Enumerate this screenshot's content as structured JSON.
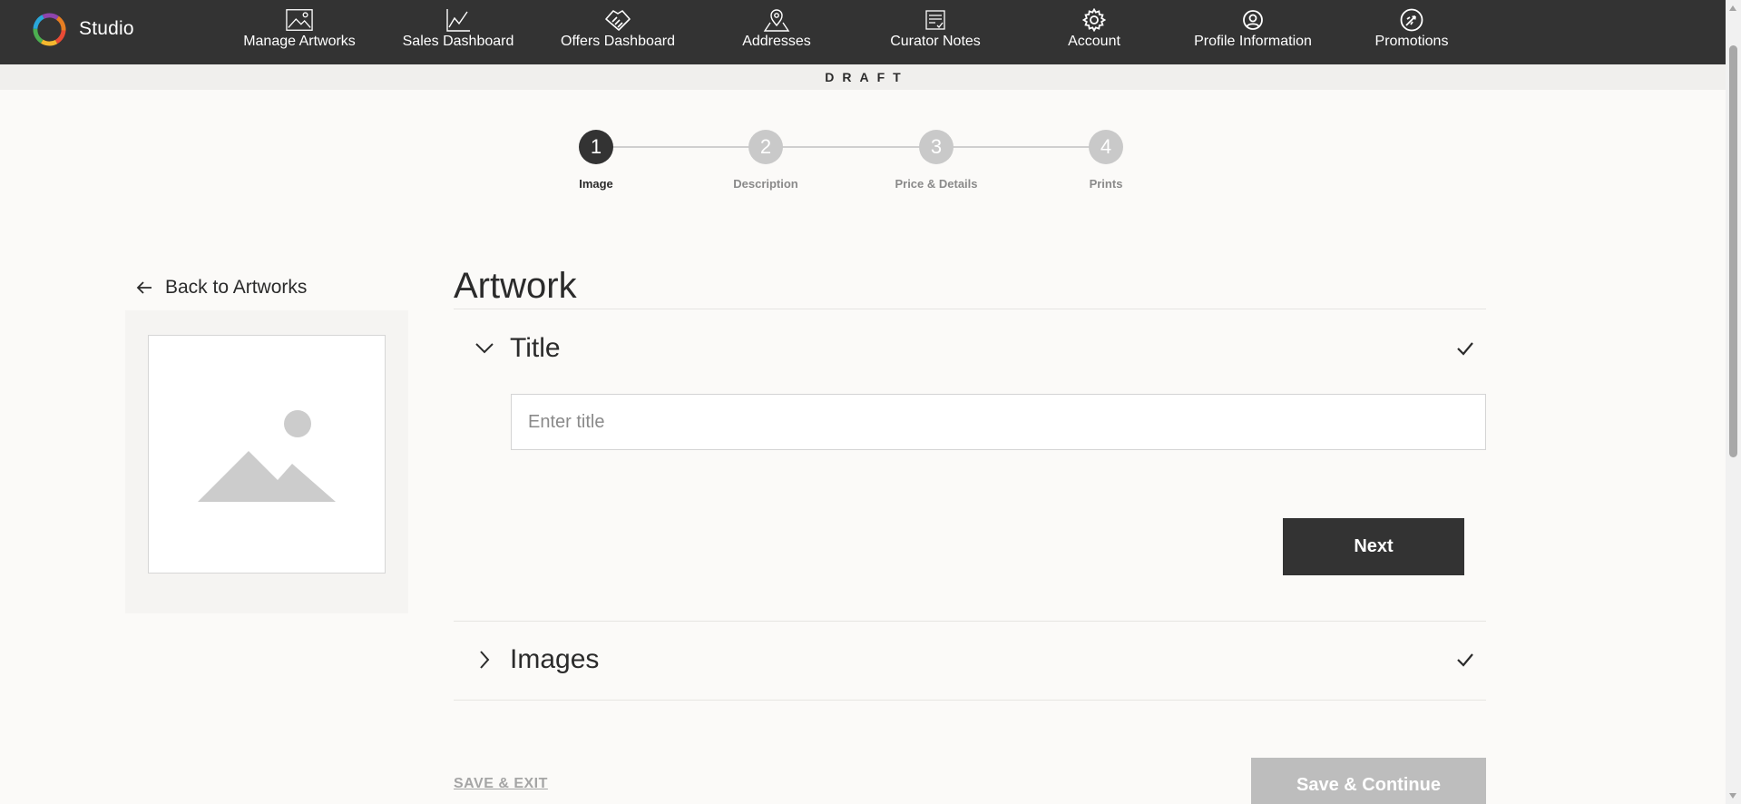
{
  "app": {
    "brand_label": "Studio",
    "brand_icon": "multicolor-ring-logo"
  },
  "nav": {
    "items": [
      {
        "label": "Manage Artworks",
        "icon": "image-icon"
      },
      {
        "label": "Sales Dashboard",
        "icon": "line-chart-icon"
      },
      {
        "label": "Offers Dashboard",
        "icon": "handshake-icon"
      },
      {
        "label": "Addresses",
        "icon": "map-pin-icon"
      },
      {
        "label": "Curator Notes",
        "icon": "notes-icon"
      },
      {
        "label": "Account",
        "icon": "gear-icon"
      },
      {
        "label": "Profile Information",
        "icon": "user-circle-icon"
      },
      {
        "label": "Promotions",
        "icon": "rocket-icon"
      }
    ]
  },
  "status": {
    "draft_label": "DRAFT"
  },
  "stepper": {
    "current": 1,
    "steps": [
      {
        "number": "1",
        "label": "Image"
      },
      {
        "number": "2",
        "label": "Description"
      },
      {
        "number": "3",
        "label": "Price & Details"
      },
      {
        "number": "4",
        "label": "Prints"
      }
    ]
  },
  "sidebar": {
    "back_label": "Back to Artworks",
    "preview_icon": "image-placeholder-icon"
  },
  "main": {
    "heading": "Artwork",
    "title_section": {
      "label": "Title",
      "expanded": true,
      "complete": true,
      "input_value": "",
      "input_placeholder": "Enter title",
      "next_label": "Next"
    },
    "images_section": {
      "label": "Images",
      "expanded": false,
      "complete": true
    }
  },
  "footer": {
    "save_exit_label": "SAVE & EXIT",
    "save_continue_label": "Save & Continue"
  },
  "colors": {
    "nav_bg": "#333333",
    "page_bg": "#fbfaf8",
    "active_step": "#333333",
    "inactive_step": "#c9c9c9",
    "disabled_button": "#bdbdbd"
  }
}
